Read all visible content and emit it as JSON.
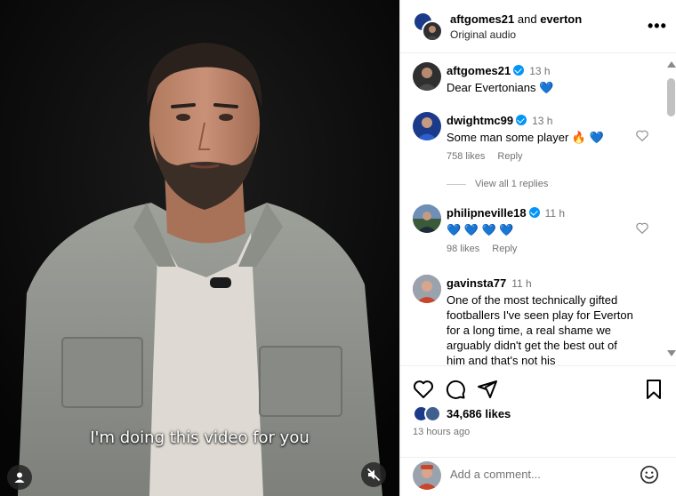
{
  "video": {
    "caption": "I'm doing this video for you"
  },
  "header": {
    "user1": "aftgomes21",
    "joiner": "and",
    "user2": "everton",
    "audio": "Original audio",
    "more": "•••"
  },
  "comments": [
    {
      "user": "aftgomes21",
      "verified": true,
      "time": "13 h",
      "text": "Dear Evertonians 💙"
    },
    {
      "user": "dwightmc99",
      "verified": true,
      "time": "13 h",
      "text": "Some man some player 🔥 💙",
      "likes": "758 likes",
      "reply": "Reply",
      "view_replies": "View all 1 replies"
    },
    {
      "user": "philipneville18",
      "verified": true,
      "time": "11 h",
      "text": "💙 💙 💙 💙",
      "likes": "98 likes",
      "reply": "Reply"
    },
    {
      "user": "gavinsta77",
      "verified": false,
      "time": "11 h",
      "text": "One of the most technically gifted footballers I've seen play for Everton for a long time, a real shame we arguably didn't get the best out of him and that's not his"
    }
  ],
  "post": {
    "likes_count": "34,686 likes",
    "posted": "13 hours ago"
  },
  "composer": {
    "placeholder": "Add a comment..."
  },
  "colors": {
    "verified": "#0095f6",
    "everton_blue": "#1b3a8a",
    "secondary_text": "#737373"
  }
}
